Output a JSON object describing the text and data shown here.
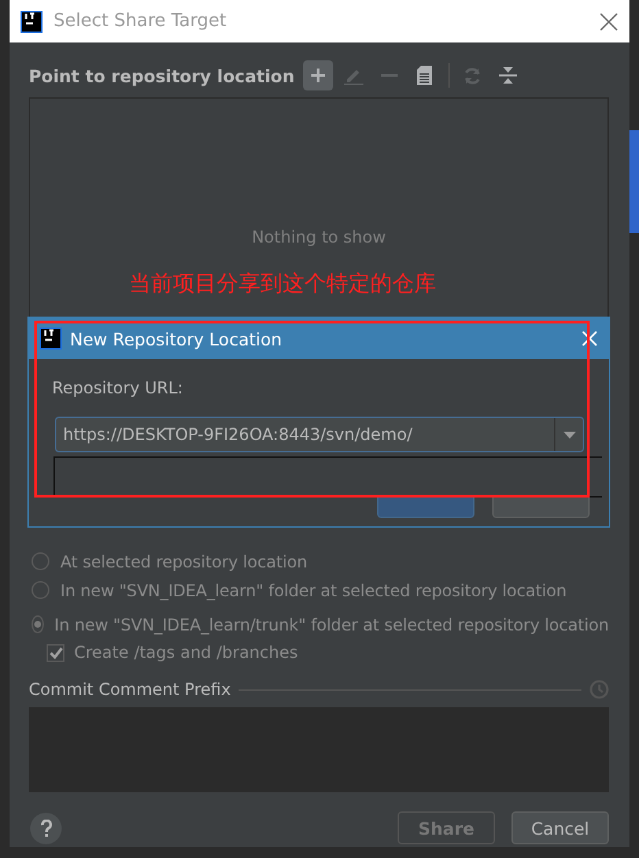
{
  "window": {
    "title": "Select Share Target"
  },
  "repository_section": {
    "title": "Point to repository location",
    "toolbar": [
      {
        "kind": "add",
        "disabled": false
      },
      {
        "kind": "edit",
        "disabled": true
      },
      {
        "kind": "remove",
        "disabled": true
      },
      {
        "kind": "browse",
        "disabled": false
      },
      {
        "kind": "refresh",
        "disabled": true
      },
      {
        "kind": "collapse",
        "disabled": false
      }
    ],
    "empty_text": "Nothing to show"
  },
  "annotation": {
    "text": "当前项目分享到这个特定的仓库"
  },
  "popup": {
    "title": "New Repository Location",
    "label": "Repository URL:",
    "url": "https://DESKTOP-9FI26OA:8443/svn/demo/"
  },
  "share_target": {
    "options": [
      {
        "label": "At selected repository location",
        "selected": false
      },
      {
        "label": "In new \"SVN_IDEA_learn\" folder at selected repository location",
        "selected": false
      },
      {
        "label": "In new \"SVN_IDEA_learn/trunk\" folder at selected repository location",
        "selected": true
      }
    ],
    "create_tags": {
      "label": "Create /tags and /branches",
      "checked": true
    }
  },
  "commit_prefix": {
    "label": "Commit Comment Prefix"
  },
  "buttons": [
    {
      "label": "Share",
      "disabled": true
    },
    {
      "label": "Cancel",
      "disabled": false
    }
  ]
}
